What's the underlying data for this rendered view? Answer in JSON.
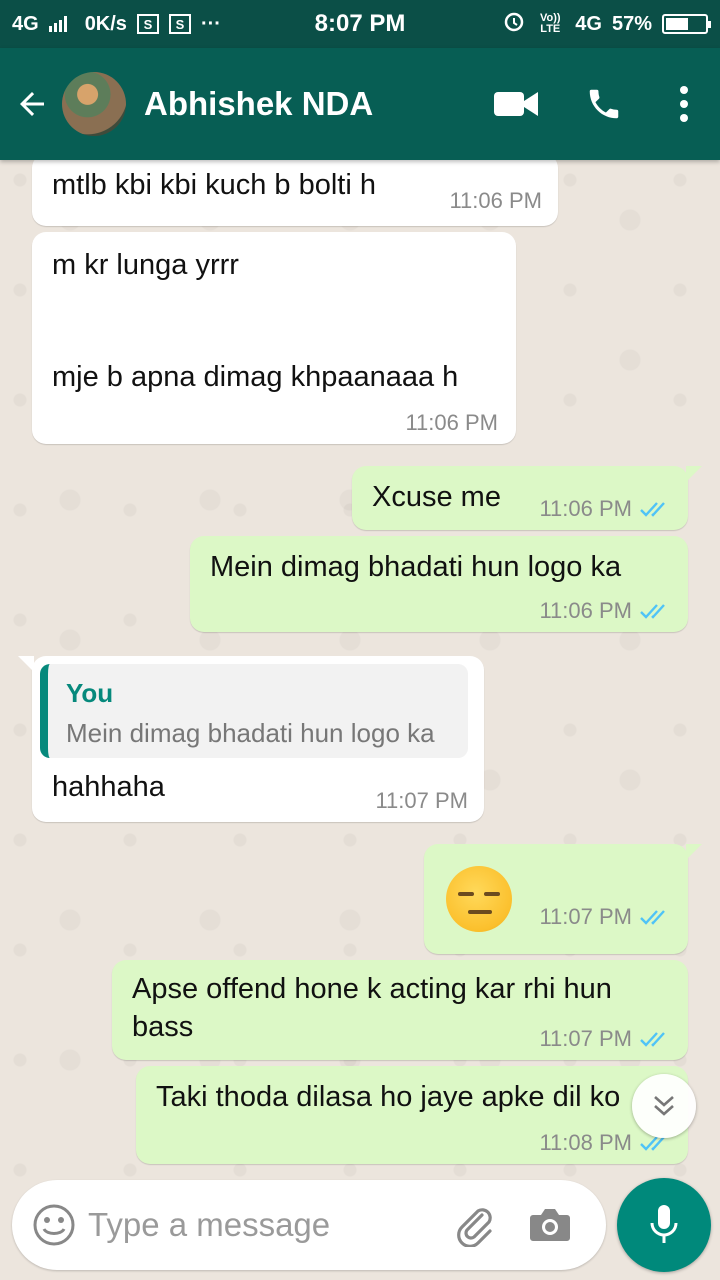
{
  "status_bar": {
    "network": "4G",
    "speed": "0K/s",
    "icon_s1": "S",
    "icon_s2": "S",
    "more_dots": "···",
    "time": "8:07 PM",
    "volte": "Vo)) LTE",
    "network_right": "4G",
    "battery": "57%",
    "battery_level": 0.57
  },
  "header": {
    "contact_name": "Abhishek NDA",
    "icons": [
      "back-arrow-icon",
      "video-call-icon",
      "phone-icon",
      "more-vertical-icon"
    ]
  },
  "messages": [
    {
      "direction": "in",
      "text": "mtlb kbi kbi kuch b bolti h",
      "time": "11:06 PM"
    },
    {
      "direction": "in",
      "line1": "m kr lunga yrrr",
      "line2": "mje b apna dimag khpaanaaa h",
      "time": "11:06 PM"
    },
    {
      "direction": "out",
      "text": "Xcuse me",
      "time": "11:06 PM",
      "status": "read"
    },
    {
      "direction": "out",
      "text": "Mein dimag bhadati hun logo ka",
      "time": "11:06 PM",
      "status": "read"
    },
    {
      "direction": "in",
      "quote_author": "You",
      "quote_text": "Mein dimag bhadati hun logo ka",
      "text": "hahhaha",
      "time": "11:07 PM"
    },
    {
      "direction": "out",
      "emoji": "expressionless-face",
      "time": "11:07 PM",
      "status": "read"
    },
    {
      "direction": "out",
      "line1": "Apse offend hone k acting kar rhi hun",
      "line2": "bass",
      "time": "11:07 PM",
      "status": "read"
    },
    {
      "direction": "out",
      "text": "Taki thoda dilasa ho jaye apke dil ko",
      "time": "11:08 PM",
      "status": "read"
    }
  ],
  "composer": {
    "placeholder": "Type a message",
    "value": ""
  },
  "colors": {
    "status_bar": "#0b4f47",
    "header": "#075e54",
    "chat_bg": "#ece5dd",
    "incoming": "#ffffff",
    "outgoing": "#dcf8c6",
    "read_ticks": "#4fc3f7",
    "accent": "#00897b",
    "quote_accent": "#06897c"
  }
}
